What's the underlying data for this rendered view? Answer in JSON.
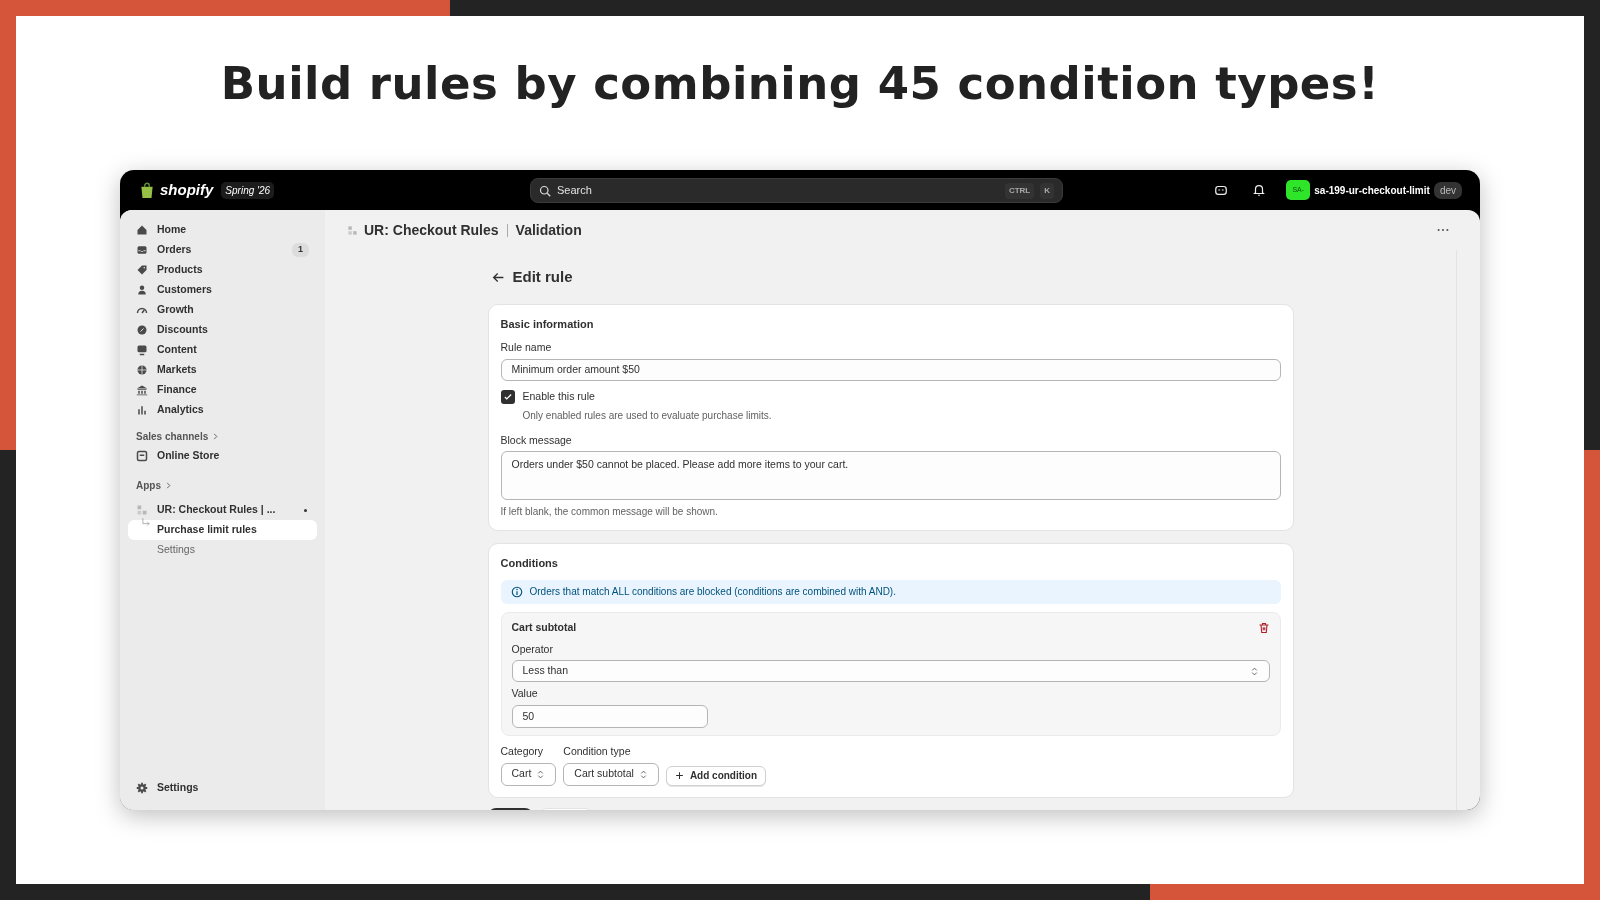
{
  "slide": {
    "title": "Build rules by combining 45 condition types!"
  },
  "topbar": {
    "logo": "shopify",
    "edition": "Spring '26",
    "search": {
      "placeholder": "Search"
    },
    "shortcut": [
      "CTRL",
      "K"
    ],
    "store": {
      "avatar": "SA-",
      "name": "sa-199-ur-checkout-limit",
      "badge": "dev"
    }
  },
  "sidebar": {
    "items": [
      {
        "kind": "item",
        "label": "Home",
        "selected": false
      },
      {
        "kind": "item",
        "label": "Orders",
        "badge": "1",
        "selected": false
      },
      {
        "kind": "item",
        "label": "Products",
        "selected": false
      },
      {
        "kind": "item",
        "label": "Customers",
        "selected": false
      },
      {
        "kind": "item",
        "label": "Growth",
        "selected": false
      },
      {
        "kind": "item",
        "label": "Discounts",
        "selected": false
      },
      {
        "kind": "item",
        "label": "Content",
        "selected": false
      },
      {
        "kind": "item",
        "label": "Markets",
        "selected": false
      },
      {
        "kind": "item",
        "label": "Finance",
        "selected": false
      },
      {
        "kind": "item",
        "label": "Analytics",
        "selected": false
      },
      {
        "kind": "section",
        "label": "Sales channels"
      },
      {
        "kind": "item",
        "label": "Online Store",
        "selected": false
      },
      {
        "kind": "section",
        "label": "Apps"
      },
      {
        "kind": "app",
        "label": "UR: Checkout Rules | ...",
        "selected": false
      },
      {
        "kind": "subitem",
        "label": "Purchase limit rules",
        "selected": true
      },
      {
        "kind": "subitem",
        "label": "Settings",
        "selected": false
      }
    ],
    "footer": {
      "label": "Settings"
    }
  },
  "page": {
    "breadcrumb": {
      "app": "UR: Checkout Rules",
      "page": "Validation"
    },
    "heading": "Edit rule",
    "basic": {
      "title": "Basic information",
      "rule_name": {
        "label": "Rule name",
        "value": "Minimum order amount $50"
      },
      "enable": {
        "label": "Enable this rule",
        "hint": "Only enabled rules are used to evaluate purchase limits.",
        "checked": true
      },
      "block_message": {
        "label": "Block message",
        "value": "Orders under $50 cannot be placed. Please add more items to your cart.",
        "help": "If left blank, the common message will be shown."
      }
    },
    "conditions": {
      "title": "Conditions",
      "info": "Orders that match ALL conditions are blocked (conditions are combined with AND).",
      "items": [
        {
          "title": "Cart subtotal",
          "operator": {
            "label": "Operator",
            "value": "Less than"
          },
          "value": {
            "label": "Value",
            "value": "50"
          }
        }
      ],
      "category": {
        "label": "Category",
        "value": "Cart"
      },
      "condition_type": {
        "label": "Condition type",
        "value": "Cart subtotal"
      },
      "add_button": "Add condition"
    }
  }
}
